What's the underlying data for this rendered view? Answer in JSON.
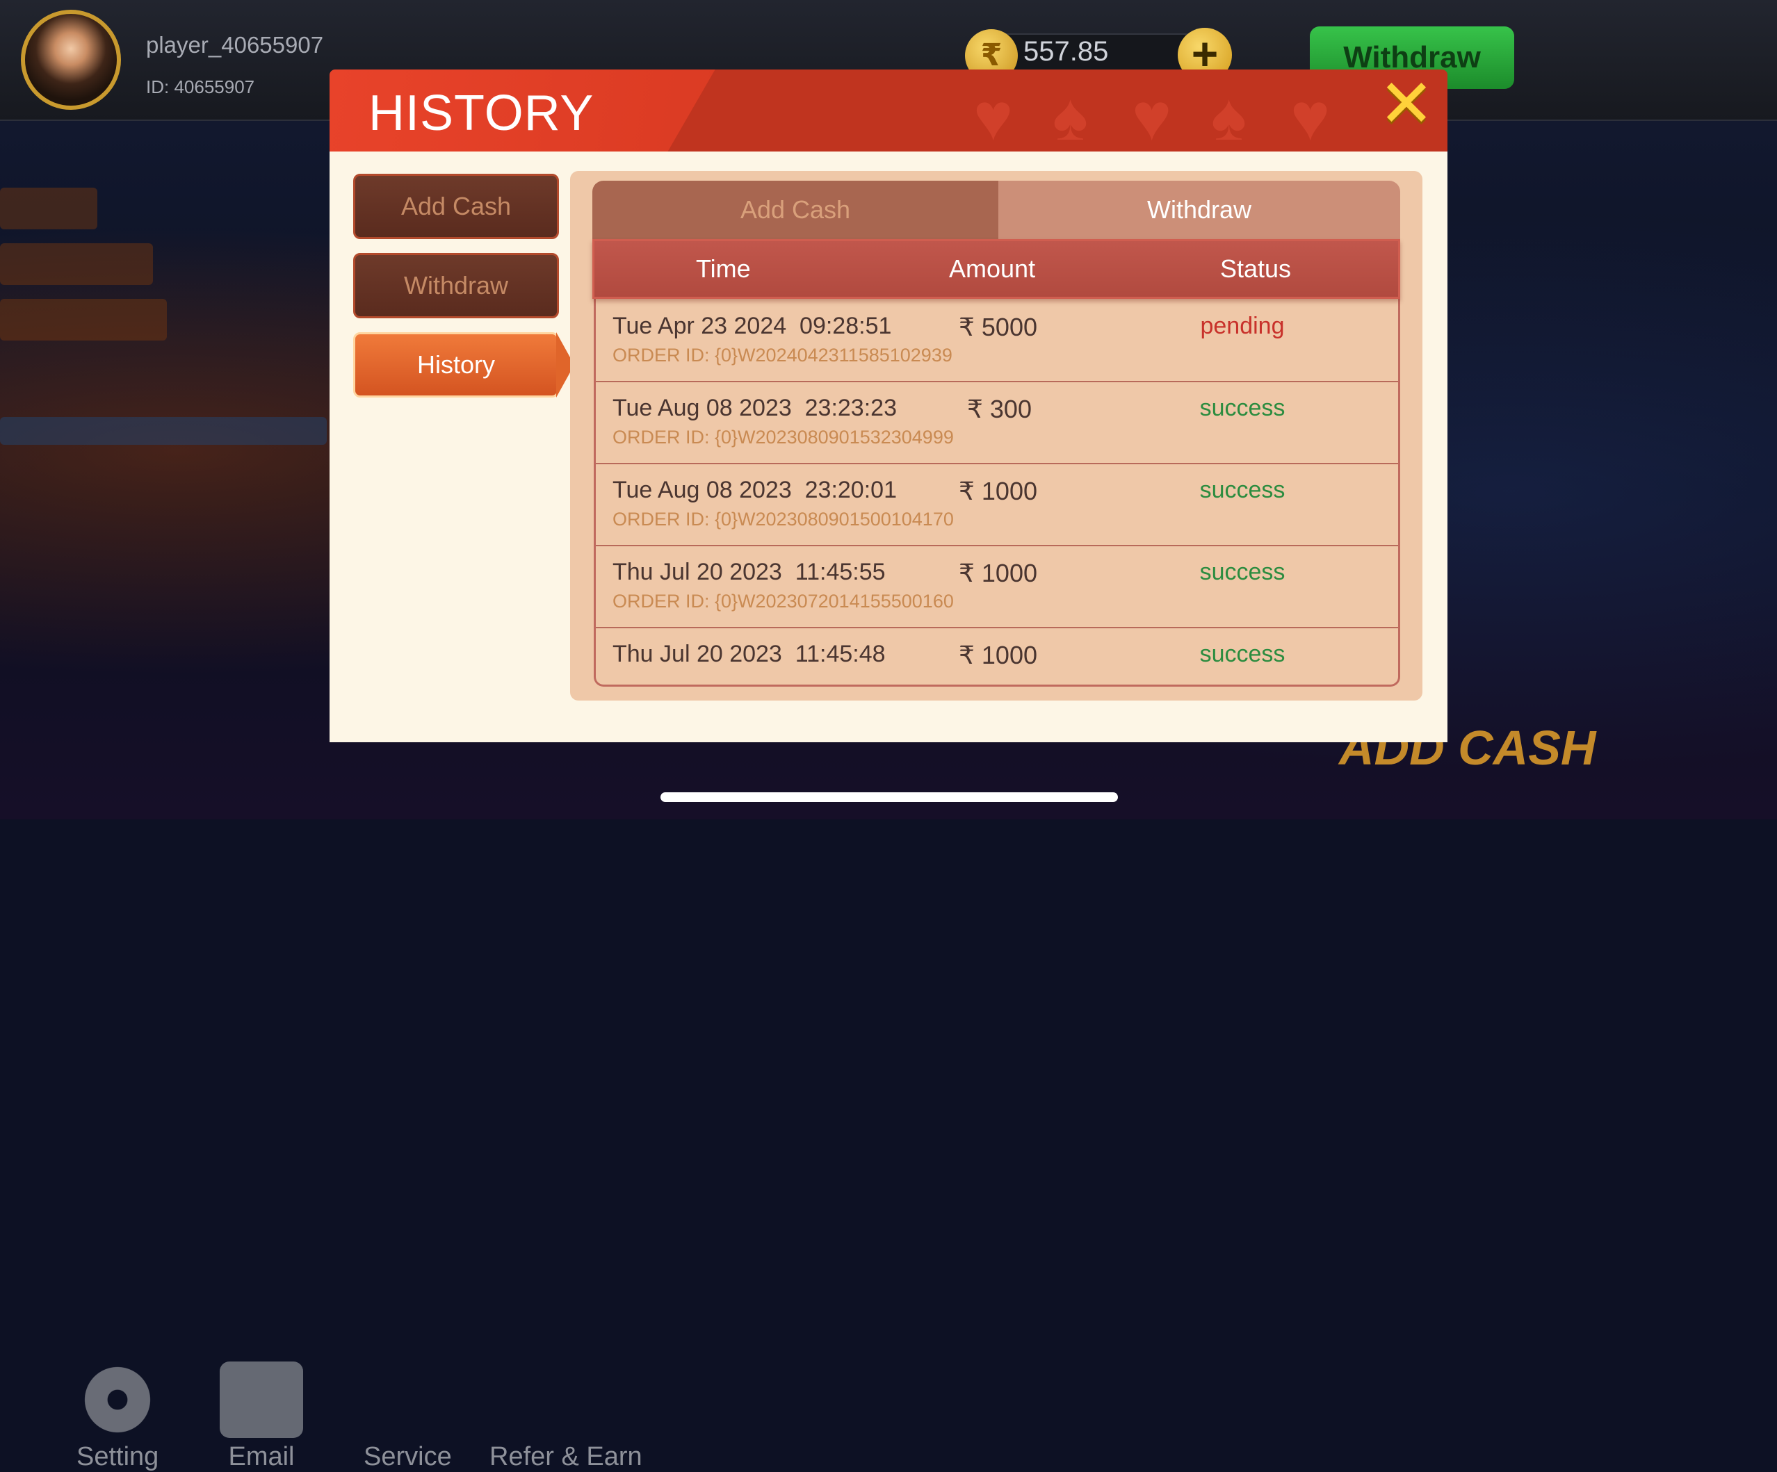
{
  "player": {
    "name": "player_40655907",
    "id": "ID: 40655907"
  },
  "balance": {
    "currency_icon": "rupee-coin",
    "value": "557.85",
    "add_icon": "plus"
  },
  "top_withdraw_label": "Withdraw",
  "modal": {
    "title": "HISTORY",
    "close_icon": "close-x",
    "sidebar": [
      {
        "label": "Add Cash",
        "active": false
      },
      {
        "label": "Withdraw",
        "active": false
      },
      {
        "label": "History",
        "active": true
      }
    ],
    "tabs": [
      {
        "label": "Add Cash",
        "active": false
      },
      {
        "label": "Withdraw",
        "active": true
      }
    ],
    "columns": {
      "time": "Time",
      "amount": "Amount",
      "status": "Status"
    },
    "rows": [
      {
        "time": "Tue Apr 23 2024  09:28:51",
        "amount": "₹ 5000",
        "status": "pending",
        "order": "ORDER ID: {0}W2024042311585102939"
      },
      {
        "time": "Tue Aug 08 2023  23:23:23",
        "amount": "₹ 300",
        "status": "success",
        "order": "ORDER ID: {0}W2023080901532304999"
      },
      {
        "time": "Tue Aug 08 2023  23:20:01",
        "amount": "₹ 1000",
        "status": "success",
        "order": "ORDER ID: {0}W2023080901500104170"
      },
      {
        "time": "Thu Jul 20 2023  11:45:55",
        "amount": "₹ 1000",
        "status": "success",
        "order": "ORDER ID: {0}W2023072014155500160"
      },
      {
        "time": "Thu Jul 20 2023  11:45:48",
        "amount": "₹ 1000",
        "status": "success",
        "order": ""
      }
    ],
    "status_colors": {
      "pending": "#c8312a",
      "success": "#2b8c3f"
    }
  },
  "bottom_nav": [
    {
      "label": "Setting",
      "icon": "gear"
    },
    {
      "label": "Email",
      "icon": "envelope"
    },
    {
      "label": "Service",
      "icon": "headset"
    },
    {
      "label": "Refer & Earn",
      "icon": "add-user"
    }
  ],
  "promo_banner": "ADD CASH"
}
